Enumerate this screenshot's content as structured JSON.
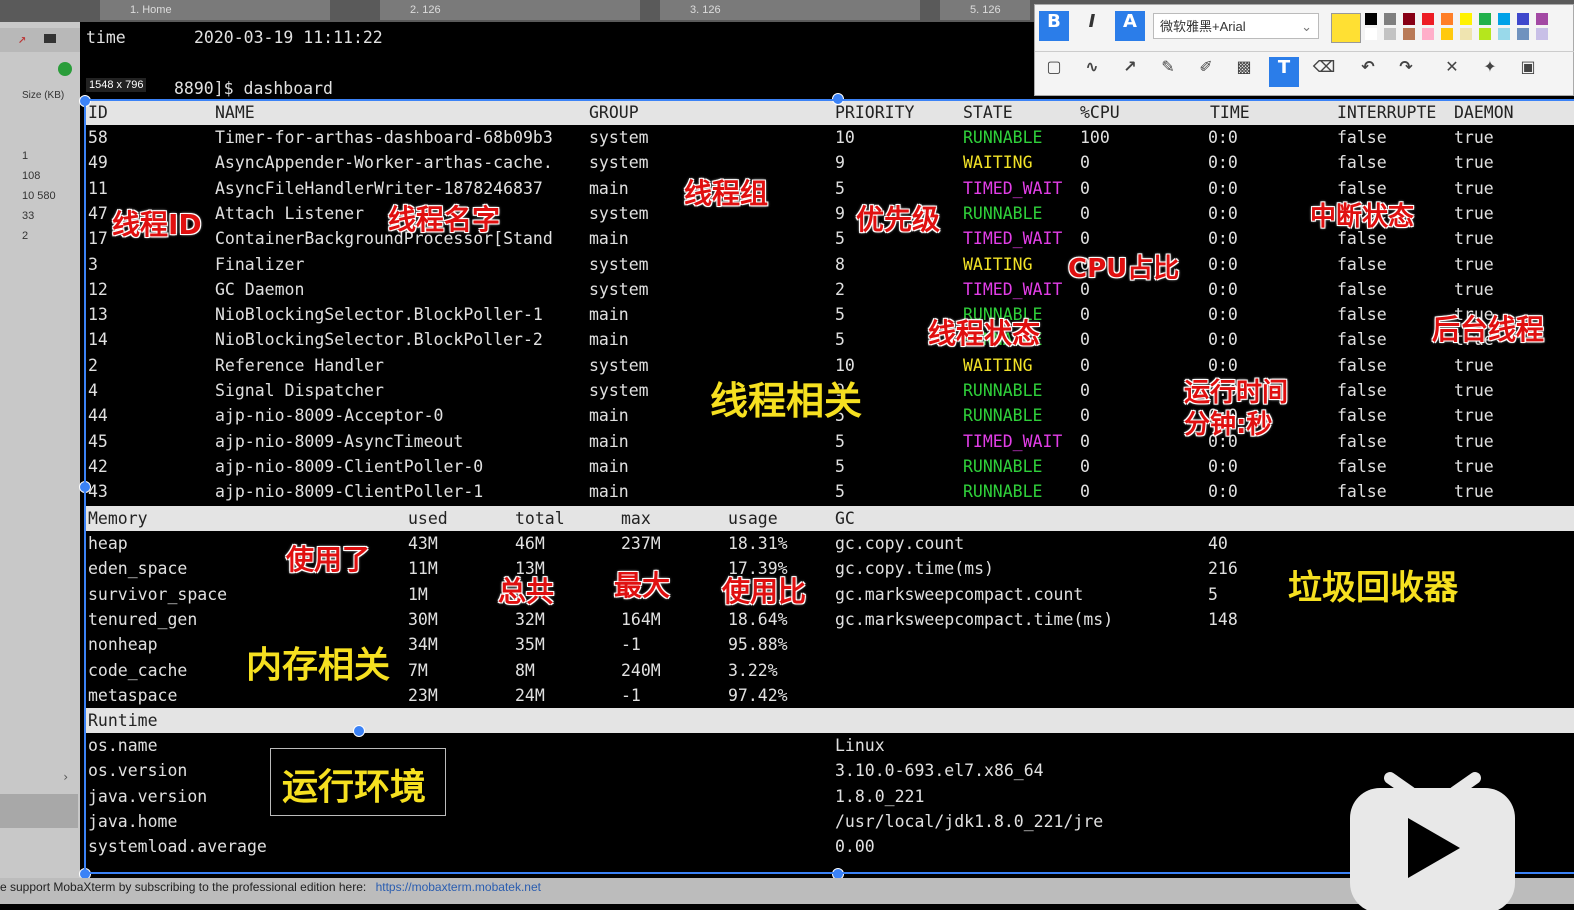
{
  "tabs": [
    {
      "label": "1. Home"
    },
    {
      "label": "2. 126"
    },
    {
      "label": "3. 126"
    },
    {
      "label": "5. 126"
    }
  ],
  "left_panel": {
    "size_label": "Size (KB)",
    "values": [
      "1",
      "108",
      "10 580",
      "33",
      "2"
    ]
  },
  "size_badge": "1548 x 796",
  "terminal": {
    "time_label": "time",
    "time_value": "2020-03-19 11:11:22",
    "prompt": "8890]$ dashboard",
    "thread_headers": [
      "ID",
      "NAME",
      "GROUP",
      "PRIORITY",
      "STATE",
      "%CPU",
      "TIME",
      "INTERRUPTE",
      "DAEMON"
    ],
    "threads": [
      {
        "id": "58",
        "name": "Timer-for-arthas-dashboard-68b09b3",
        "group": "system",
        "priority": "10",
        "state": "RUNNABLE",
        "cpu": "100",
        "time": "0:0",
        "interrupted": "false",
        "daemon": "true"
      },
      {
        "id": "49",
        "name": "AsyncAppender-Worker-arthas-cache.",
        "group": "system",
        "priority": "9",
        "state": "WAITING",
        "cpu": "0",
        "time": "0:0",
        "interrupted": "false",
        "daemon": "true"
      },
      {
        "id": "11",
        "name": "AsyncFileHandlerWriter-1878246837",
        "group": "main",
        "priority": "5",
        "state": "TIMED_WAIT",
        "cpu": "0",
        "time": "0:0",
        "interrupted": "false",
        "daemon": "true"
      },
      {
        "id": "47",
        "name": "Attach Listener",
        "group": "system",
        "priority": "9",
        "state": "RUNNABLE",
        "cpu": "0",
        "time": "0:0",
        "interrupted": "false",
        "daemon": "true"
      },
      {
        "id": "17",
        "name": "ContainerBackgroundProcessor[Stand",
        "group": "main",
        "priority": "5",
        "state": "TIMED_WAIT",
        "cpu": "0",
        "time": "0:0",
        "interrupted": "false",
        "daemon": "true"
      },
      {
        "id": "3",
        "name": "Finalizer",
        "group": "system",
        "priority": "8",
        "state": "WAITING",
        "cpu": "0",
        "time": "0:0",
        "interrupted": "false",
        "daemon": "true"
      },
      {
        "id": "12",
        "name": "GC Daemon",
        "group": "system",
        "priority": "2",
        "state": "TIMED_WAIT",
        "cpu": "0",
        "time": "0:0",
        "interrupted": "false",
        "daemon": "true"
      },
      {
        "id": "13",
        "name": "NioBlockingSelector.BlockPoller-1",
        "group": "main",
        "priority": "5",
        "state": "RUNNABLE",
        "cpu": "0",
        "time": "0:0",
        "interrupted": "false",
        "daemon": "true"
      },
      {
        "id": "14",
        "name": "NioBlockingSelector.BlockPoller-2",
        "group": "main",
        "priority": "5",
        "state": "RUNNABLE",
        "cpu": "0",
        "time": "0:0",
        "interrupted": "false",
        "daemon": "true"
      },
      {
        "id": "2",
        "name": "Reference Handler",
        "group": "system",
        "priority": "10",
        "state": "WAITING",
        "cpu": "0",
        "time": "0:0",
        "interrupted": "false",
        "daemon": "true"
      },
      {
        "id": "4",
        "name": "Signal Dispatcher",
        "group": "system",
        "priority": "9",
        "state": "RUNNABLE",
        "cpu": "0",
        "time": "0:0",
        "interrupted": "false",
        "daemon": "true"
      },
      {
        "id": "44",
        "name": "ajp-nio-8009-Acceptor-0",
        "group": "main",
        "priority": "5",
        "state": "RUNNABLE",
        "cpu": "0",
        "time": "0:0",
        "interrupted": "false",
        "daemon": "true"
      },
      {
        "id": "45",
        "name": "ajp-nio-8009-AsyncTimeout",
        "group": "main",
        "priority": "5",
        "state": "TIMED_WAIT",
        "cpu": "0",
        "time": "0:0",
        "interrupted": "false",
        "daemon": "true"
      },
      {
        "id": "42",
        "name": "ajp-nio-8009-ClientPoller-0",
        "group": "main",
        "priority": "5",
        "state": "RUNNABLE",
        "cpu": "0",
        "time": "0:0",
        "interrupted": "false",
        "daemon": "true"
      },
      {
        "id": "43",
        "name": "ajp-nio-8009-ClientPoller-1",
        "group": "main",
        "priority": "5",
        "state": "RUNNABLE",
        "cpu": "0",
        "time": "0:0",
        "interrupted": "false",
        "daemon": "true"
      }
    ],
    "memory_headers": [
      "Memory",
      "used",
      "total",
      "max",
      "usage",
      "GC"
    ],
    "memory": [
      {
        "name": "heap",
        "used": "43M",
        "total": "46M",
        "max": "237M",
        "usage": "18.31%"
      },
      {
        "name": "eden_space",
        "used": "11M",
        "total": "13M",
        "max": "",
        "usage": "17.39%"
      },
      {
        "name": "survivor_space",
        "used": "1M",
        "total": "",
        "max": "",
        "usage": ""
      },
      {
        "name": "tenured_gen",
        "used": "30M",
        "total": "32M",
        "max": "164M",
        "usage": "18.64%"
      },
      {
        "name": "nonheap",
        "used": "34M",
        "total": "35M",
        "max": "-1",
        "usage": "95.88%"
      },
      {
        "name": "code_cache",
        "used": "7M",
        "total": "8M",
        "max": "240M",
        "usage": "3.22%"
      },
      {
        "name": "metaspace",
        "used": "23M",
        "total": "24M",
        "max": "-1",
        "usage": "97.42%"
      }
    ],
    "gc": [
      {
        "name": "gc.copy.count",
        "value": "40"
      },
      {
        "name": "gc.copy.time(ms)",
        "value": "216"
      },
      {
        "name": "gc.marksweepcompact.count",
        "value": "5"
      },
      {
        "name": "gc.marksweepcompact.time(ms)",
        "value": "148"
      }
    ],
    "runtime_header": "Runtime",
    "runtime": [
      {
        "name": "os.name",
        "value": "Linux"
      },
      {
        "name": "os.version",
        "value": "3.10.0-693.el7.x86_64"
      },
      {
        "name": "java.version",
        "value": "1.8.0_221"
      },
      {
        "name": "java.home",
        "value": "/usr/local/jdk1.8.0_221/jre"
      },
      {
        "name": "systemload.average",
        "value": "0.00"
      }
    ]
  },
  "annotations": {
    "thread_id": "线程ID",
    "thread_name": "线程名字",
    "thread_group": "线程组",
    "priority": "优先级",
    "cpu": "CPU占比",
    "interrupt": "中断状态",
    "thread_state": "线程状态",
    "daemon": "后台线程",
    "thread_related": "线程相关",
    "run_time_1": "运行时间",
    "run_time_2": "分钟:秒",
    "used": "使用了",
    "total": "总共",
    "max": "最大",
    "usage": "使用比",
    "gc": "垃圾回收器",
    "memory_related": "内存相关",
    "runtime_env": "运行环境"
  },
  "toolbar": {
    "font_name": "微软雅黑+Arial",
    "swatch_colors": [
      "#000000",
      "#7f7f7f",
      "#880015",
      "#ed1c24",
      "#ff7f27",
      "#fff200",
      "#22b14c",
      "#00a2e8",
      "#3f48cc",
      "#a349a4",
      "#ffffff",
      "#c3c3c3",
      "#b97a57",
      "#ffaec9",
      "#ffc90e",
      "#efe4b0",
      "#b5e61d",
      "#99d9ea",
      "#7092be",
      "#c8bfe7"
    ],
    "current_color": "#ffe033"
  },
  "status_bar": {
    "text": "e support MobaXterm by subscribing to the professional edition here:",
    "link": "https://mobaxterm.mobatek.net"
  }
}
